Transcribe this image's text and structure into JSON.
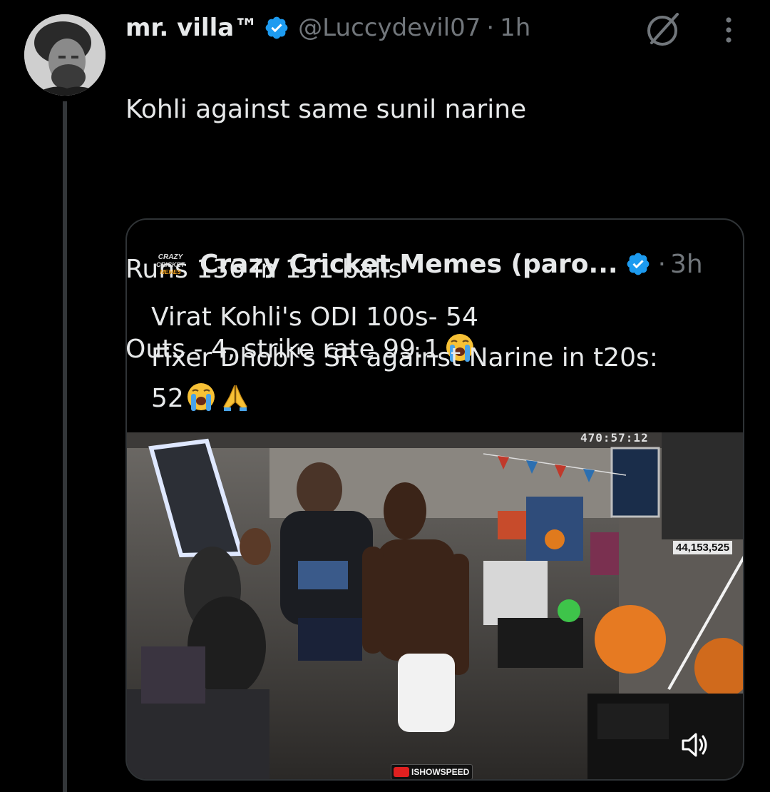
{
  "author": {
    "display_name": "mr. villa™",
    "handle": "@Luccydevil07",
    "separator": "·",
    "time": "1h"
  },
  "tweet": {
    "lines": [
      "Kohli against same sunil narine",
      "",
      "Runs 136 in 131 balls",
      "Outs - 4, strike rate 99.1"
    ],
    "trailing_emoji": "loudly-crying-face"
  },
  "quoted_tweet": {
    "logo_text": "CRAZY CRICKET MEMES",
    "display_name": "Crazy Cricket Memes (paro...",
    "separator": "·",
    "time": "3h",
    "lines": [
      "Virat Kohli's ODI 100s- 54",
      "Fixer Dhobi's SR against Narine in t20s:",
      "52"
    ],
    "trailing_emojis": [
      "loudly-crying-face",
      "folded-hands"
    ],
    "media": {
      "stream_timer": "470:57:12",
      "viewer_count": "44,153,525",
      "watermark": "ISHOWSPEED",
      "volume_icon": "speaker-on-icon"
    }
  },
  "colors": {
    "background": "#000000",
    "text_primary": "#e7e9ea",
    "text_secondary": "#71767b",
    "verified_blue": "#1d9bf0",
    "border": "#2f3336"
  },
  "icons": {
    "grok": "grok-icon",
    "more": "more-icon",
    "verified": "verified-badge-icon"
  }
}
